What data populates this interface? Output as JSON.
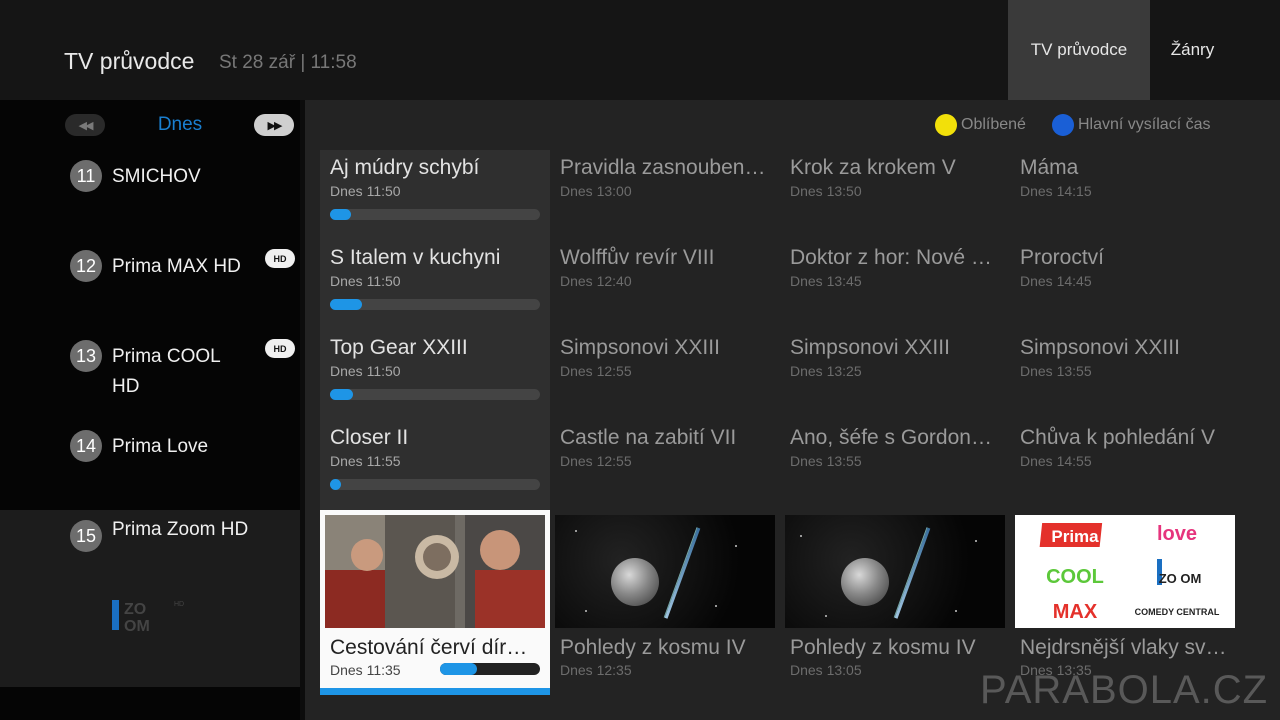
{
  "header": {
    "title": "TV průvodce",
    "datetime": "St 28 zář | 11:58",
    "tabs": [
      {
        "label": "TV průvodce",
        "active": true
      },
      {
        "label": "Žánry",
        "active": false
      }
    ]
  },
  "day_nav": {
    "prev_icon": "rewind-icon",
    "label": "Dnes",
    "next_icon": "fast-forward-icon",
    "prev_glyph": "◀◀",
    "next_glyph": "▶▶"
  },
  "legend": [
    {
      "label": "Oblíbené",
      "color": "#f2e00a"
    },
    {
      "label": "Hlavní vysílací čas",
      "color": "#1a5fd6"
    }
  ],
  "channels": [
    {
      "number": "11",
      "name": "SMICHOV",
      "hd": false
    },
    {
      "number": "12",
      "name": "Prima MAX HD",
      "hd": true,
      "hd_label": "HD"
    },
    {
      "number": "13",
      "name": "Prima COOL HD",
      "hd": true,
      "hd_label": "HD"
    },
    {
      "number": "14",
      "name": "Prima Love",
      "hd": false
    },
    {
      "number": "15",
      "name": "Prima Zoom HD",
      "hd": false,
      "selected": true
    }
  ],
  "zoom_logo": {
    "line1": "ZO",
    "line2": "OM",
    "hd": "HD"
  },
  "programs": [
    [
      {
        "title": "Aj múdry schybí",
        "time": "Dnes 11:50",
        "progress": 0.1
      },
      {
        "title": "Pravidla zasnouben…",
        "time": "Dnes 13:00"
      },
      {
        "title": "Krok za krokem V",
        "time": "Dnes 13:50"
      },
      {
        "title": "Máma",
        "time": "Dnes 14:15"
      }
    ],
    [
      {
        "title": "S Italem v kuchyni",
        "time": "Dnes 11:50",
        "progress": 0.15
      },
      {
        "title": "Wolffův revír VIII",
        "time": "Dnes 12:40"
      },
      {
        "title": "Doktor z hor: Nové …",
        "time": "Dnes 13:45"
      },
      {
        "title": "Proroctví",
        "time": "Dnes 14:45"
      }
    ],
    [
      {
        "title": "Top Gear XXIII",
        "time": "Dnes 11:50",
        "progress": 0.11
      },
      {
        "title": "Simpsonovi XXIII",
        "time": "Dnes 12:55"
      },
      {
        "title": "Simpsonovi XXIII",
        "time": "Dnes 13:25"
      },
      {
        "title": "Simpsonovi XXIII",
        "time": "Dnes 13:55"
      }
    ],
    [
      {
        "title": "Closer II",
        "time": "Dnes 11:55",
        "progress": 0.05
      },
      {
        "title": "Castle na zabití VII",
        "time": "Dnes 12:55"
      },
      {
        "title": "Ano, šéfe s Gordon…",
        "time": "Dnes 13:55"
      },
      {
        "title": "Chůva k pohledání V",
        "time": "Dnes 14:55"
      }
    ]
  ],
  "thumb_row": [
    {
      "title": "Cestování červí dír…",
      "time": "Dnes 11:35",
      "progress": 0.37,
      "image": "scene-people"
    },
    {
      "title": "Pohledy z kosmu IV",
      "time": "Dnes 12:35",
      "image": "space-probe"
    },
    {
      "title": "Pohledy z kosmu IV",
      "time": "Dnes 13:05",
      "image": "space-probe"
    },
    {
      "title": "Nejdrsnější vlaky sv…",
      "time": "Dnes 13:35",
      "image": "channel-logos"
    }
  ],
  "logo_grid": [
    "Prima",
    "love",
    "COOL",
    "ZO OM",
    "MAX",
    "COMEDY CENTRAL"
  ],
  "watermark": "PARABOLA.CZ"
}
